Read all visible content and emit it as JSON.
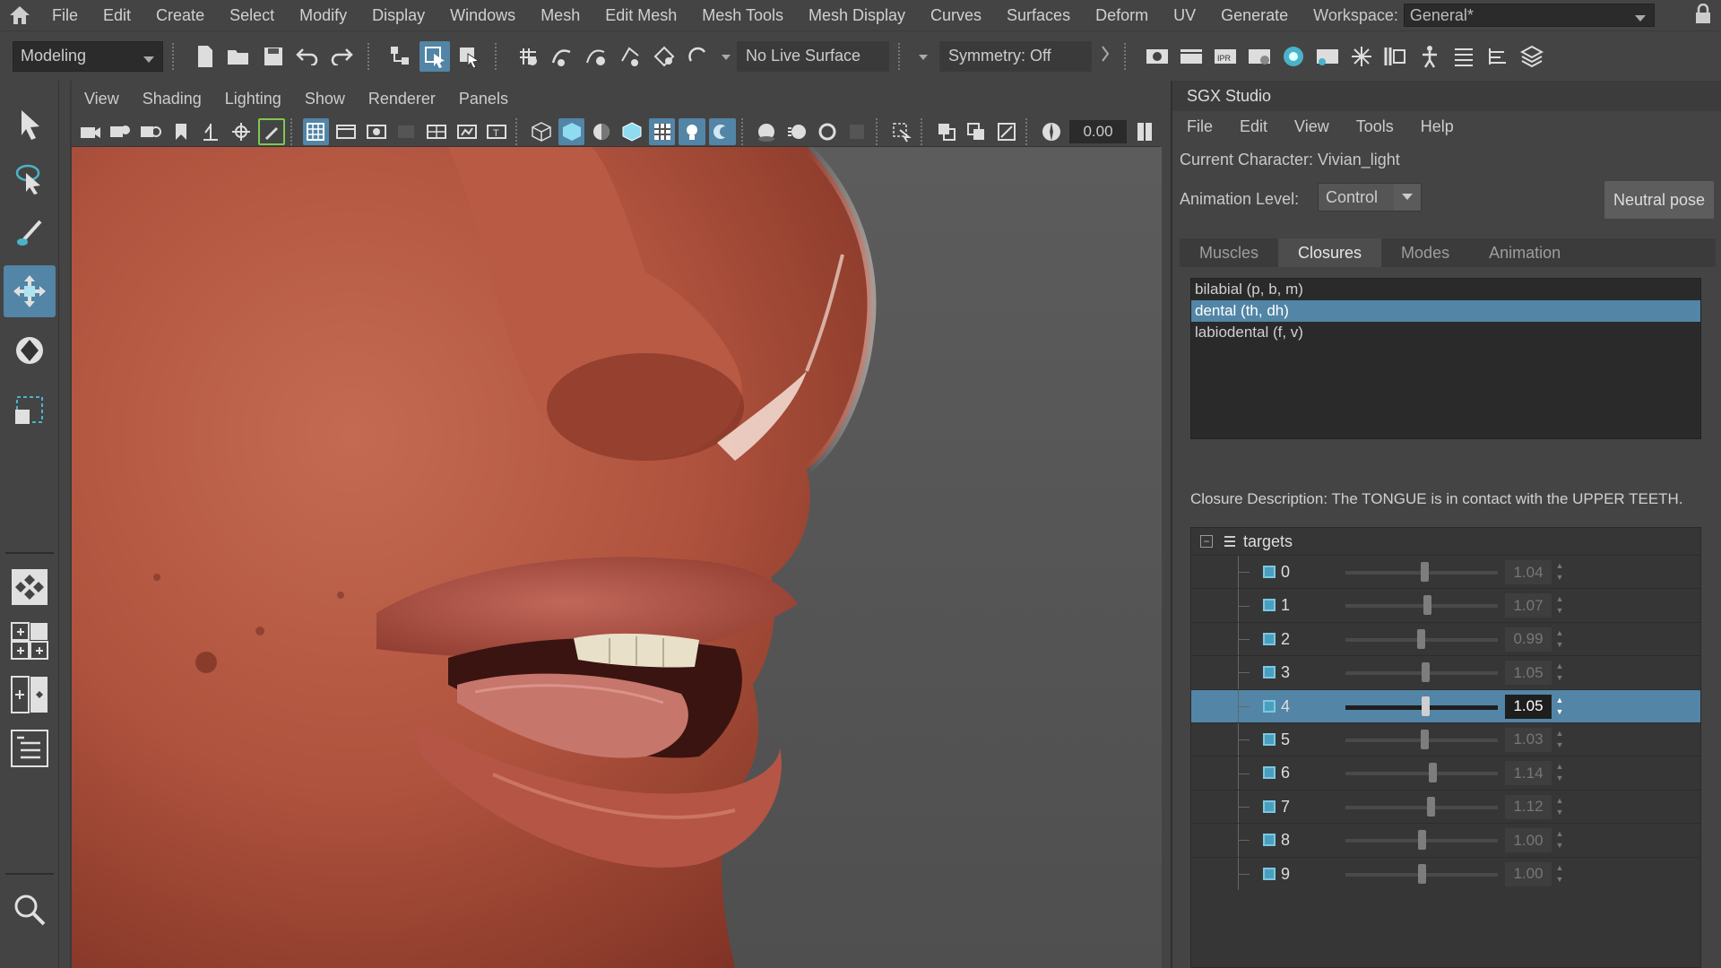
{
  "menubar": {
    "items": [
      "File",
      "Edit",
      "Create",
      "Select",
      "Modify",
      "Display",
      "Windows",
      "Mesh",
      "Edit Mesh",
      "Mesh Tools",
      "Mesh Display",
      "Curves",
      "Surfaces",
      "Deform",
      "UV",
      "Generate"
    ],
    "workspace_label": "Workspace:",
    "workspace_value": "General*"
  },
  "statusline": {
    "mode": "Modeling",
    "live_surface": "No Live Surface",
    "symmetry": "Symmetry: Off"
  },
  "viewport": {
    "menu": [
      "View",
      "Shading",
      "Lighting",
      "Show",
      "Renderer",
      "Panels"
    ],
    "exposure_value": "0.00"
  },
  "sgx": {
    "title": "SGX Studio",
    "menu": [
      "File",
      "Edit",
      "View",
      "Tools",
      "Help"
    ],
    "current_character": "Current Character: Vivian_light",
    "animation_level_label": "Animation Level:",
    "animation_level_value": "Control",
    "neutral_pose_label": "Neutral pose",
    "tabs": [
      "Muscles",
      "Closures",
      "Modes",
      "Animation"
    ],
    "active_tab": "Closures",
    "closures": [
      {
        "label": "bilabial  (p, b, m)",
        "selected": false
      },
      {
        "label": "dental  (th, dh)",
        "selected": true
      },
      {
        "label": "labiodental  (f, v)",
        "selected": false
      }
    ],
    "closure_description": "Closure Description: The TONGUE is in contact with the UPPER TEETH.",
    "targets_label": "targets",
    "targets": [
      {
        "name": "0",
        "value": "1.04",
        "selected": false
      },
      {
        "name": "1",
        "value": "1.07",
        "selected": false
      },
      {
        "name": "2",
        "value": "0.99",
        "selected": false
      },
      {
        "name": "3",
        "value": "1.05",
        "selected": false
      },
      {
        "name": "4",
        "value": "1.05",
        "selected": true
      },
      {
        "name": "5",
        "value": "1.03",
        "selected": false
      },
      {
        "name": "6",
        "value": "1.14",
        "selected": false
      },
      {
        "name": "7",
        "value": "1.12",
        "selected": false
      },
      {
        "name": "8",
        "value": "1.00",
        "selected": false
      },
      {
        "name": "9",
        "value": "1.00",
        "selected": false
      }
    ]
  },
  "colors": {
    "accent": "#5285a6",
    "panel": "#444444",
    "skin": "#b85a44"
  }
}
